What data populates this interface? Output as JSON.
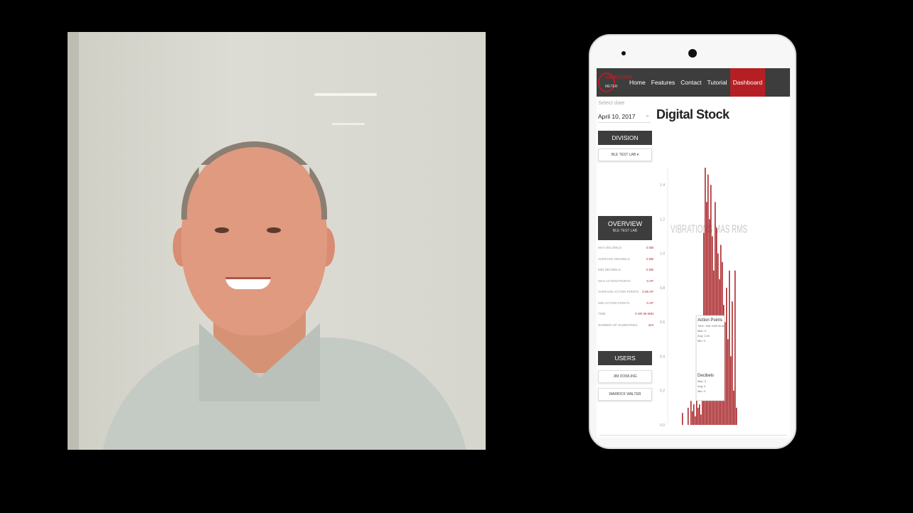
{
  "nav": {
    "logo_text": "VIBRATION",
    "logo_sub": "METER",
    "items": [
      "Home",
      "Features",
      "Contact",
      "Tutorial",
      "Dashboard"
    ]
  },
  "sidebar": {
    "select_label": "Select date",
    "date_value": "April 10, 2017",
    "division_title": "DIVISION",
    "division_button": "BLE TEST LAB",
    "overview_title": "OVERVIEW",
    "overview_sub": "BLE TEST LAB",
    "stats": [
      {
        "label": "MAX DECIBELS",
        "value": "0 DB"
      },
      {
        "label": "AVERAGE DECIBELS",
        "value": "0 DB"
      },
      {
        "label": "MIN DECIBELS",
        "value": "0 DB"
      },
      {
        "label": "MAX ACTION POINTS",
        "value": "0 AP"
      },
      {
        "label": "AVERAGE ACTION POINTS",
        "value": "0.06 AP"
      },
      {
        "label": "MIN ACTION POINTS",
        "value": "0 AP"
      },
      {
        "label": "TIME",
        "value": "0 HR 06 MIN"
      },
      {
        "label": "NUMBER OF SUMMARIES",
        "value": "424"
      }
    ],
    "users_title": "USERS",
    "users": [
      "JIM DOWLING",
      "WARRICK WALTER"
    ]
  },
  "main": {
    "title": "Digital Stock"
  },
  "chart_data": {
    "type": "bar",
    "title": "VIBRATIONS MAS RMS",
    "ylim": [
      0,
      1.5
    ],
    "yticks": [
      0.0,
      0.2,
      0.4,
      0.6,
      0.8,
      1.0,
      1.2,
      1.4
    ],
    "grid": false,
    "series": [
      {
        "values": [
          0.07,
          0,
          0,
          0,
          0.1,
          0,
          0.14,
          0.08,
          0.12,
          0.05,
          0.18,
          0.1,
          0.12,
          0.06,
          0.62,
          1.12,
          1.52,
          1.3,
          1.46,
          1.2,
          1.4,
          1.1,
          0.9,
          1.3,
          1.15,
          1.0,
          0.85,
          1.05,
          0.95,
          0.7,
          0.6,
          0.8,
          0.5,
          0.9,
          0.4,
          0.72,
          0.2,
          0.9,
          0.1
        ]
      }
    ],
    "tooltip": {
      "title1": "Action Points",
      "line1": "Time: 11th 4:00:00 am",
      "line2": "Max: 0",
      "line3": "Avg: 1.04",
      "line4": "Min: 0",
      "title2": "Decibels",
      "line5": "Max: 0",
      "line6": "Avg: 0",
      "line7": "Min: 0"
    }
  }
}
